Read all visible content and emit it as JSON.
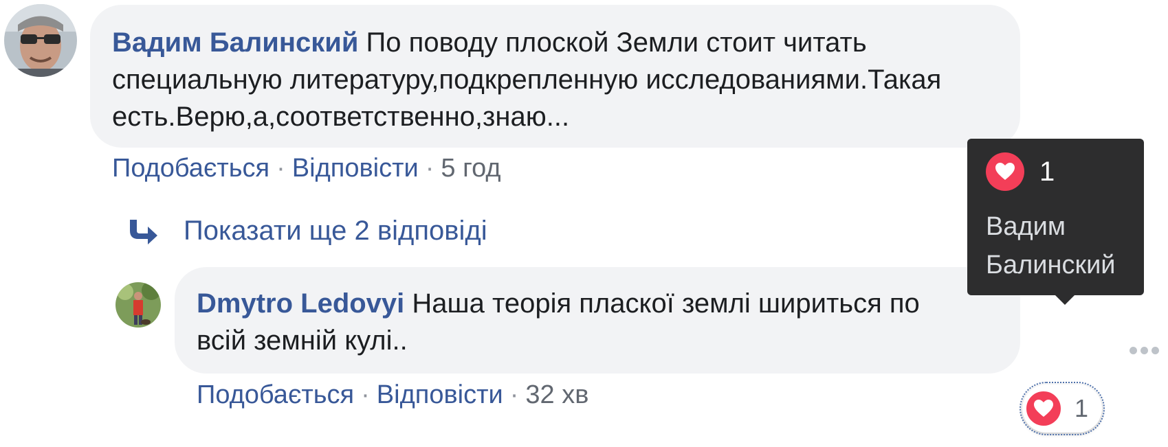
{
  "comments": [
    {
      "author": "Вадим Балинский",
      "text": "По поводу плоской Земли стоит читать специальную литературу,подкрепленную исследованиями.Такая есть.Верю,а,соответственно,знаю...",
      "like_label": "Подобається",
      "reply_label": "Відповісти",
      "time": "5 год"
    },
    {
      "author": "Dmytro Ledovyi",
      "text": "Наша теорія пласкої землі шириться по всій земній кулі..",
      "like_label": "Подобається",
      "reply_label": "Відповісти",
      "time": "32 хв",
      "reaction_count": "1"
    }
  ],
  "more_replies_label": "Показати ще 2 відповіді",
  "tooltip": {
    "count": "1",
    "names": "Вадим Балинский"
  },
  "icons": {
    "reaction": "heart-icon",
    "more_replies": "reply-arrow-icon",
    "options": "more-dots-icon"
  },
  "colors": {
    "link": "#385898",
    "bubble": "#f2f3f5",
    "heart": "#f33e58",
    "tooltip": "#2d2d2e"
  }
}
